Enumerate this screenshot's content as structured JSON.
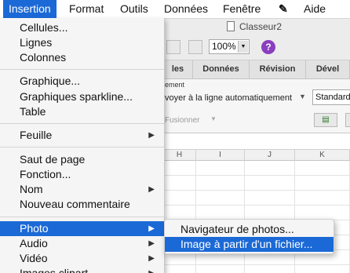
{
  "menubar": {
    "items": [
      "Insertion",
      "Format",
      "Outils",
      "Données",
      "Fenêtre",
      "Aide"
    ],
    "script_icon": "✎"
  },
  "window": {
    "title": "Classeur2",
    "zoom": "100%",
    "help": "?"
  },
  "ribbon": {
    "tabs": [
      "les",
      "Données",
      "Révision",
      "Dével"
    ],
    "alignment_label": "ement",
    "wrap_text": "voyer à la ligne automatiquement",
    "merge": "Fusionner",
    "number_format": "Standard"
  },
  "grid": {
    "columns": [
      "H",
      "I",
      "J",
      "K"
    ]
  },
  "insert_menu": {
    "items": [
      {
        "label": "Cellules..."
      },
      {
        "label": "Lignes"
      },
      {
        "label": "Colonnes"
      },
      {
        "label": "Graphique..."
      },
      {
        "label": "Graphiques sparkline..."
      },
      {
        "label": "Table"
      },
      {
        "label": "Feuille",
        "submenu": true
      },
      {
        "label": "Saut de page"
      },
      {
        "label": "Fonction..."
      },
      {
        "label": "Nom",
        "submenu": true
      },
      {
        "label": "Nouveau commentaire"
      },
      {
        "label": "Photo",
        "submenu": true,
        "highlighted": true
      },
      {
        "label": "Audio",
        "submenu": true
      },
      {
        "label": "Vidéo",
        "submenu": true
      },
      {
        "label": "Images clipart",
        "submenu": true
      }
    ]
  },
  "photo_submenu": {
    "items": [
      {
        "label": "Navigateur de photos..."
      },
      {
        "label": "Image à partir d'un fichier...",
        "highlighted": true
      }
    ]
  },
  "colors": {
    "highlight": "#1b69d6",
    "menu_bg": "#f5f5f5"
  }
}
